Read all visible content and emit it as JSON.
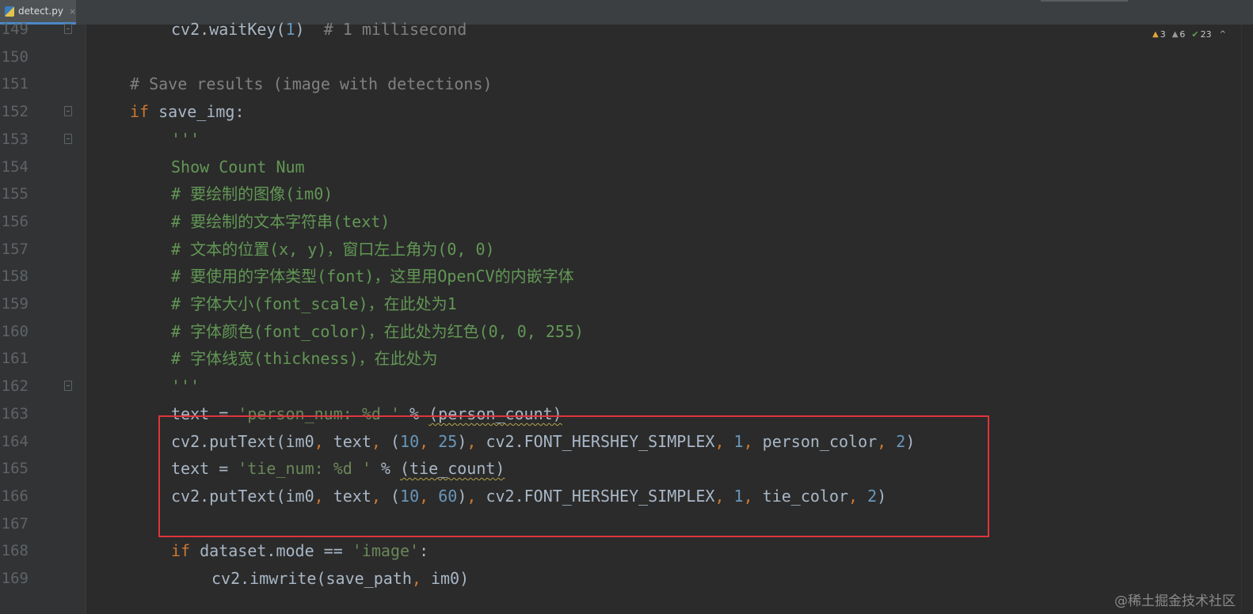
{
  "tab": {
    "filename": "detect.py",
    "close": "×"
  },
  "inspections": {
    "warnings": "3",
    "weak_warnings": "6",
    "typos": "23"
  },
  "watermark": "@稀土掘金技术社区",
  "lines": [
    {
      "num": "149",
      "indent": 2,
      "tokens": [
        {
          "t": "cv2.waitKey(",
          "c": "op"
        },
        {
          "t": "1",
          "c": "num"
        },
        {
          "t": ")  ",
          "c": "op"
        },
        {
          "t": "# 1 millisecond",
          "c": "comment"
        }
      ]
    },
    {
      "num": "150",
      "indent": 0,
      "tokens": []
    },
    {
      "num": "151",
      "indent": 1,
      "tokens": [
        {
          "t": "# Save results (image with detections)",
          "c": "comment"
        }
      ]
    },
    {
      "num": "152",
      "indent": 1,
      "tokens": [
        {
          "t": "if ",
          "c": "kw"
        },
        {
          "t": "save_img:",
          "c": "op"
        }
      ]
    },
    {
      "num": "153",
      "indent": 2,
      "tokens": [
        {
          "t": "'''",
          "c": "doc"
        }
      ]
    },
    {
      "num": "154",
      "indent": 2,
      "tokens": [
        {
          "t": "Show Count Num",
          "c": "doc"
        }
      ]
    },
    {
      "num": "155",
      "indent": 2,
      "tokens": [
        {
          "t": "# 要绘制的图像(im0)",
          "c": "doc"
        }
      ]
    },
    {
      "num": "156",
      "indent": 2,
      "tokens": [
        {
          "t": "# 要绘制的文本字符串(text)",
          "c": "doc"
        }
      ]
    },
    {
      "num": "157",
      "indent": 2,
      "tokens": [
        {
          "t": "# 文本的位置(x, y)，窗口左上角为(0, 0)",
          "c": "doc"
        }
      ]
    },
    {
      "num": "158",
      "indent": 2,
      "tokens": [
        {
          "t": "# 要使用的字体类型(font)，这里用OpenCV的内嵌字体",
          "c": "doc"
        }
      ]
    },
    {
      "num": "159",
      "indent": 2,
      "tokens": [
        {
          "t": "# 字体大小(font_scale)，在此处为1",
          "c": "doc"
        }
      ]
    },
    {
      "num": "160",
      "indent": 2,
      "tokens": [
        {
          "t": "# 字体颜色(font_color)，在此处为红色(0, 0, 255)",
          "c": "doc"
        }
      ]
    },
    {
      "num": "161",
      "indent": 2,
      "tokens": [
        {
          "t": "# 字体线宽(thickness)，在此处为",
          "c": "doc"
        }
      ]
    },
    {
      "num": "162",
      "indent": 2,
      "tokens": [
        {
          "t": "'''",
          "c": "doc"
        }
      ]
    },
    {
      "num": "163",
      "indent": 2,
      "tokens": [
        {
          "t": "text = ",
          "c": "op"
        },
        {
          "t": "'person_num: %d '",
          "c": "str"
        },
        {
          "t": " % ",
          "c": "op"
        },
        {
          "t": "(person_count)",
          "c": "op",
          "squig": true
        }
      ]
    },
    {
      "num": "164",
      "indent": 2,
      "tokens": [
        {
          "t": "cv2.putText(im0",
          "c": "op"
        },
        {
          "t": ", ",
          "c": "kw"
        },
        {
          "t": "text",
          "c": "op"
        },
        {
          "t": ", ",
          "c": "kw"
        },
        {
          "t": "(",
          "c": "op"
        },
        {
          "t": "10",
          "c": "num"
        },
        {
          "t": ", ",
          "c": "kw"
        },
        {
          "t": "25",
          "c": "num"
        },
        {
          "t": ")",
          "c": "op"
        },
        {
          "t": ", ",
          "c": "kw"
        },
        {
          "t": "cv2.FONT_HERSHEY_SIMPLEX",
          "c": "op"
        },
        {
          "t": ", ",
          "c": "kw"
        },
        {
          "t": "1",
          "c": "num"
        },
        {
          "t": ", ",
          "c": "kw"
        },
        {
          "t": "person_color",
          "c": "op"
        },
        {
          "t": ", ",
          "c": "kw"
        },
        {
          "t": "2",
          "c": "num"
        },
        {
          "t": ")",
          "c": "op"
        }
      ]
    },
    {
      "num": "165",
      "indent": 2,
      "tokens": [
        {
          "t": "text = ",
          "c": "op"
        },
        {
          "t": "'tie_num: %d '",
          "c": "str"
        },
        {
          "t": " % ",
          "c": "op"
        },
        {
          "t": "(tie_count)",
          "c": "op",
          "squig": true
        }
      ]
    },
    {
      "num": "166",
      "indent": 2,
      "tokens": [
        {
          "t": "cv2.putText(im0",
          "c": "op"
        },
        {
          "t": ", ",
          "c": "kw"
        },
        {
          "t": "text",
          "c": "op"
        },
        {
          "t": ", ",
          "c": "kw"
        },
        {
          "t": "(",
          "c": "op"
        },
        {
          "t": "10",
          "c": "num"
        },
        {
          "t": ", ",
          "c": "kw"
        },
        {
          "t": "60",
          "c": "num"
        },
        {
          "t": ")",
          "c": "op"
        },
        {
          "t": ", ",
          "c": "kw"
        },
        {
          "t": "cv2.FONT_HERSHEY_SIMPLEX",
          "c": "op"
        },
        {
          "t": ", ",
          "c": "kw"
        },
        {
          "t": "1",
          "c": "num"
        },
        {
          "t": ", ",
          "c": "kw"
        },
        {
          "t": "tie_color",
          "c": "op"
        },
        {
          "t": ", ",
          "c": "kw"
        },
        {
          "t": "2",
          "c": "num"
        },
        {
          "t": ")",
          "c": "op"
        }
      ]
    },
    {
      "num": "167",
      "indent": 0,
      "tokens": []
    },
    {
      "num": "168",
      "indent": 2,
      "tokens": [
        {
          "t": "if ",
          "c": "kw"
        },
        {
          "t": "dataset.mode == ",
          "c": "op"
        },
        {
          "t": "'image'",
          "c": "str"
        },
        {
          "t": ":",
          "c": "op"
        }
      ]
    },
    {
      "num": "169",
      "indent": 3,
      "tokens": [
        {
          "t": "cv2.imwrite(save_path",
          "c": "op"
        },
        {
          "t": ", ",
          "c": "kw"
        },
        {
          "t": "im0)",
          "c": "op"
        }
      ]
    }
  ]
}
